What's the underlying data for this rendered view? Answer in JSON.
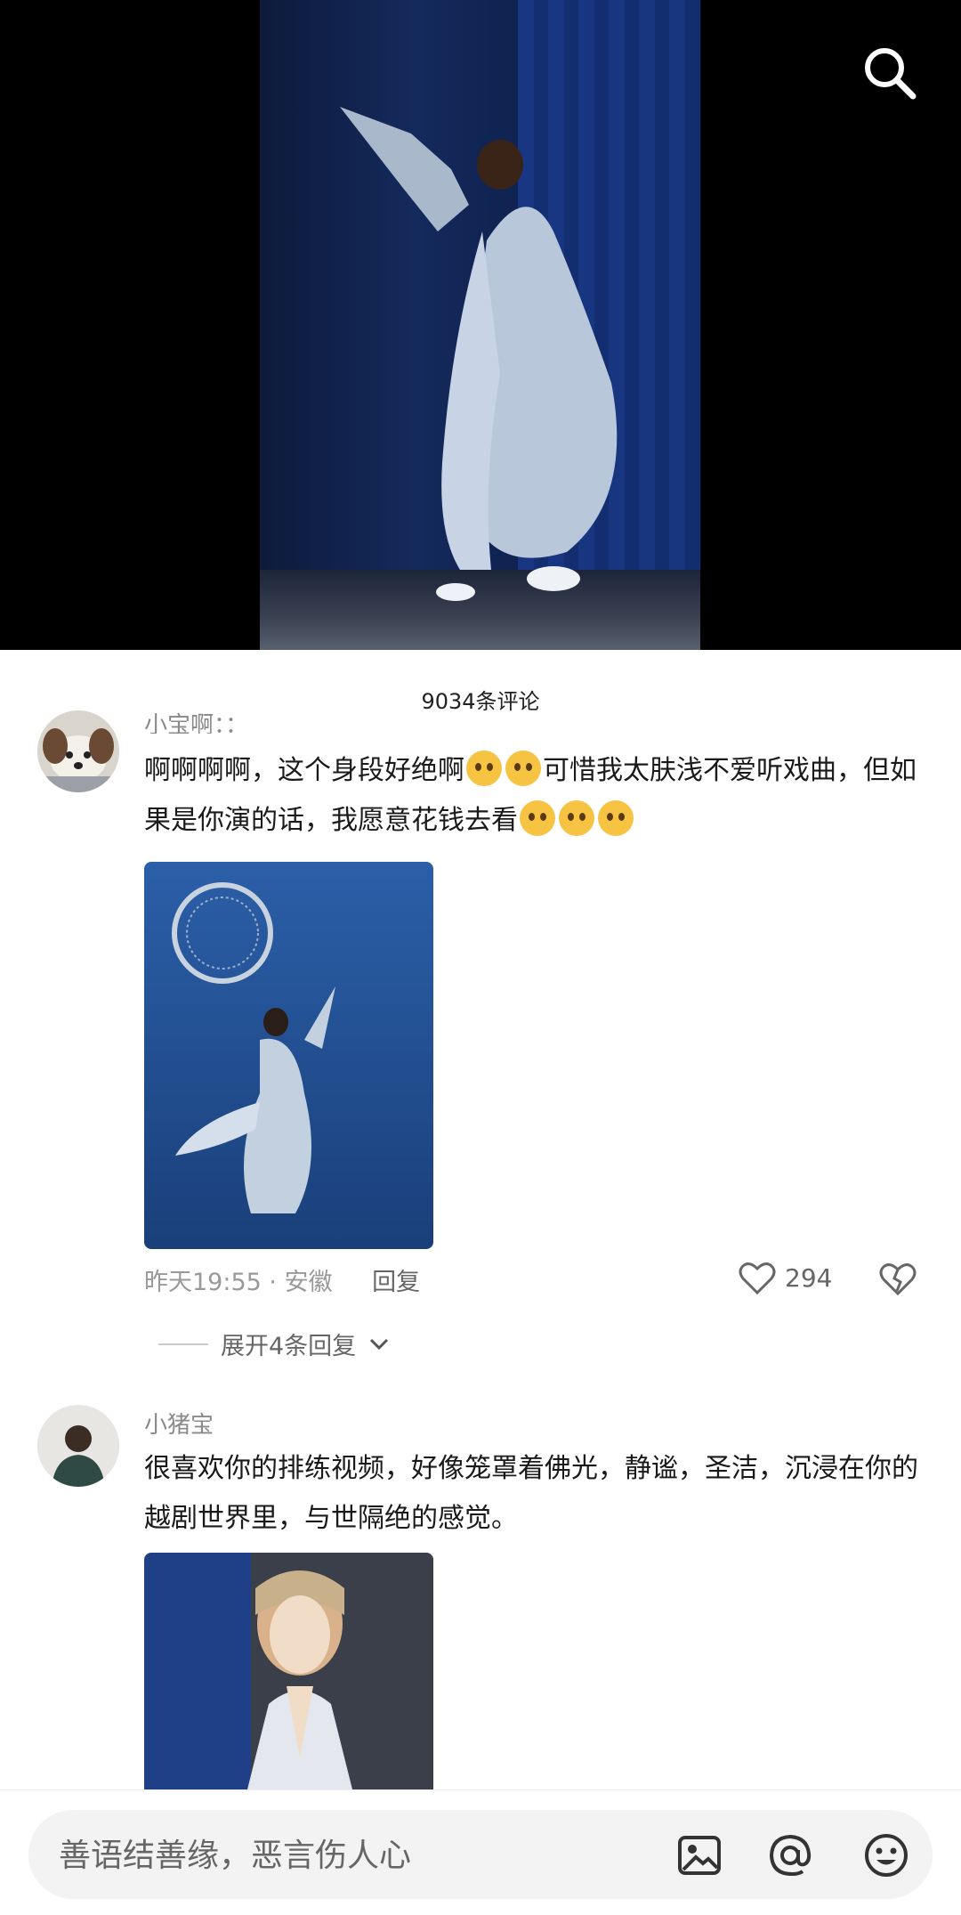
{
  "header": {
    "comment_count": "9034条评论"
  },
  "comments": [
    {
      "username": "小宝啊：：",
      "text_before": "啊啊啊啊，这个身段好绝啊",
      "text_after": "可惜我太肤浅不爱听戏曲，但如果是你演的话，我愿意花钱去看",
      "time": "昨天19:55",
      "location": "安徽",
      "reply_label": "回复",
      "likes": "294",
      "expand_label": "展开4条回复"
    },
    {
      "username": "小猪宝",
      "text": "很喜欢你的排练视频，好像笼罩着佛光，静谧，圣洁，沉浸在你的越剧世界里，与世隔绝的感觉。"
    }
  ],
  "input": {
    "placeholder": "善语结善缘，恶言伤人心"
  },
  "colors": {
    "accent_text": "#1a1a1a",
    "meta_gray": "#999999",
    "icon_gray": "#333333"
  },
  "icons": [
    "search-icon",
    "heart-icon",
    "broken-heart-icon",
    "chevron-down-icon",
    "image-icon",
    "at-icon",
    "emoji-icon"
  ]
}
